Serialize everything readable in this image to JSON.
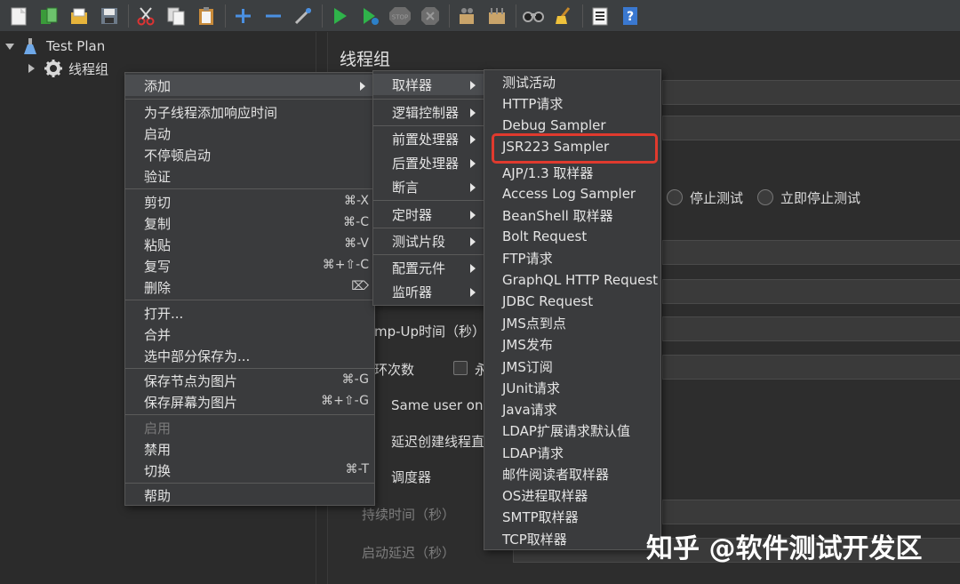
{
  "tree": {
    "test_plan": "Test Plan",
    "thread_group": "线程组"
  },
  "panel": {
    "title": "线程组",
    "stop_test": "停止测试",
    "stop_test_now": "立即停止测试",
    "rampup_label": "mp-Up时间（秒）",
    "loop_label": "环次数",
    "infinite_label": "永",
    "same_user": "Same user on e",
    "delay_create": "延迟创建线程直",
    "scheduler": "调度器",
    "duration": "持续时间（秒）",
    "startup_delay": "启动延迟（秒）"
  },
  "context_menu": {
    "items": [
      {
        "label": "添加",
        "shortcut": "",
        "submenu": true
      },
      {
        "label": "为子线程添加响应时间",
        "shortcut": ""
      },
      {
        "label": "启动",
        "shortcut": ""
      },
      {
        "label": "不停顿启动",
        "shortcut": ""
      },
      {
        "label": "验证",
        "shortcut": ""
      },
      {
        "label": "剪切",
        "shortcut": "⌘-X"
      },
      {
        "label": "复制",
        "shortcut": "⌘-C"
      },
      {
        "label": "粘贴",
        "shortcut": "⌘-V"
      },
      {
        "label": "复写",
        "shortcut": "⌘+⇧-C"
      },
      {
        "label": "删除",
        "shortcut": "⌦"
      },
      {
        "label": "打开...",
        "shortcut": ""
      },
      {
        "label": "合并",
        "shortcut": ""
      },
      {
        "label": "选中部分保存为...",
        "shortcut": ""
      },
      {
        "label": "保存节点为图片",
        "shortcut": "⌘-G"
      },
      {
        "label": "保存屏幕为图片",
        "shortcut": "⌘+⇧-G"
      },
      {
        "label": "启用",
        "shortcut": "",
        "disabled": true
      },
      {
        "label": "禁用",
        "shortcut": ""
      },
      {
        "label": "切换",
        "shortcut": "⌘-T"
      },
      {
        "label": "帮助",
        "shortcut": ""
      }
    ]
  },
  "add_submenu": {
    "items": [
      {
        "label": "取样器"
      },
      {
        "label": "逻辑控制器"
      },
      {
        "label": "前置处理器"
      },
      {
        "label": "后置处理器"
      },
      {
        "label": "断言"
      },
      {
        "label": "定时器"
      },
      {
        "label": "测试片段"
      },
      {
        "label": "配置元件"
      },
      {
        "label": "监听器"
      }
    ]
  },
  "sampler_submenu": {
    "items": [
      {
        "label": "测试活动"
      },
      {
        "label": "HTTP请求"
      },
      {
        "label": "Debug Sampler"
      },
      {
        "label": "JSR223 Sampler"
      },
      {
        "label": "AJP/1.3 取样器"
      },
      {
        "label": "Access Log Sampler"
      },
      {
        "label": "BeanShell 取样器"
      },
      {
        "label": "Bolt Request"
      },
      {
        "label": "FTP请求"
      },
      {
        "label": "GraphQL HTTP Request"
      },
      {
        "label": "JDBC Request"
      },
      {
        "label": "JMS点到点"
      },
      {
        "label": "JMS发布"
      },
      {
        "label": "JMS订阅"
      },
      {
        "label": "JUnit请求"
      },
      {
        "label": "Java请求"
      },
      {
        "label": "LDAP扩展请求默认值"
      },
      {
        "label": "LDAP请求"
      },
      {
        "label": "邮件阅读者取样器"
      },
      {
        "label": "OS进程取样器"
      },
      {
        "label": "SMTP取样器"
      },
      {
        "label": "TCP取样器"
      }
    ]
  },
  "watermark": "知乎 @软件测试开发区",
  "colors": {
    "highlight_box": "#e03a2e",
    "background": "#2b2b2b",
    "menu_bg": "#3a3b3d"
  }
}
